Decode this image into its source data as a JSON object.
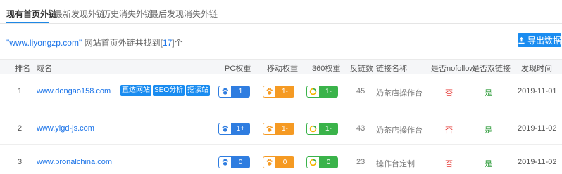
{
  "tabs": [
    {
      "label": "现有首页外链"
    },
    {
      "label": "最新发现外链"
    },
    {
      "label": "历史消失外链"
    },
    {
      "label": "最后发现消失外链"
    }
  ],
  "summary": {
    "quote_open": "\"",
    "domain": "www.liyongzp.com",
    "quote_close": "\"",
    "text_before_count": " 网站首页外链共找到[",
    "count": "17",
    "text_after_count": "]个"
  },
  "export_label": "导出数据",
  "table": {
    "headers": {
      "rank": "排名",
      "domain": "域名",
      "pc": "PC权重",
      "mobile": "移动权重",
      "w360": "360权重",
      "backlinks": "反链数",
      "linkname": "链接名称",
      "nofollow": "是否nofollow",
      "double": "是否双链接",
      "found": "发现时间"
    },
    "action_labels": {
      "visit": "直达网站",
      "seo": "SEO分析",
      "mine": "挖读站"
    },
    "rows": [
      {
        "rank": "1",
        "domain": "www.dongao158.com",
        "pc": "1",
        "mobile": "1-",
        "w360": "1-",
        "backlinks": "45",
        "linkname": "奶茶店操作台",
        "nofollow": "否",
        "double": "是",
        "found": "2019-11-01"
      },
      {
        "rank": "2",
        "domain": "www.ylgd-js.com",
        "pc": "1+",
        "mobile": "1-",
        "w360": "1-",
        "backlinks": "43",
        "linkname": "奶茶店操作台",
        "nofollow": "否",
        "double": "是",
        "found": "2019-11-02"
      },
      {
        "rank": "3",
        "domain": "www.pronalchina.com",
        "pc": "0",
        "mobile": "0",
        "w360": "0",
        "backlinks": "23",
        "linkname": "操作台定制",
        "nofollow": "否",
        "double": "是",
        "found": "2019-11-02"
      }
    ]
  },
  "colors": {
    "accent": "#1a8cf0",
    "pc": "#2f7de0",
    "mobile": "#f59a23",
    "w360": "#3ab34a",
    "no": "#e53935",
    "yes": "#2e9b3a"
  },
  "icons": {
    "pc": "paw-icon",
    "mobile": "paw-icon",
    "w360": "circle-360-icon",
    "export": "upload-icon"
  }
}
